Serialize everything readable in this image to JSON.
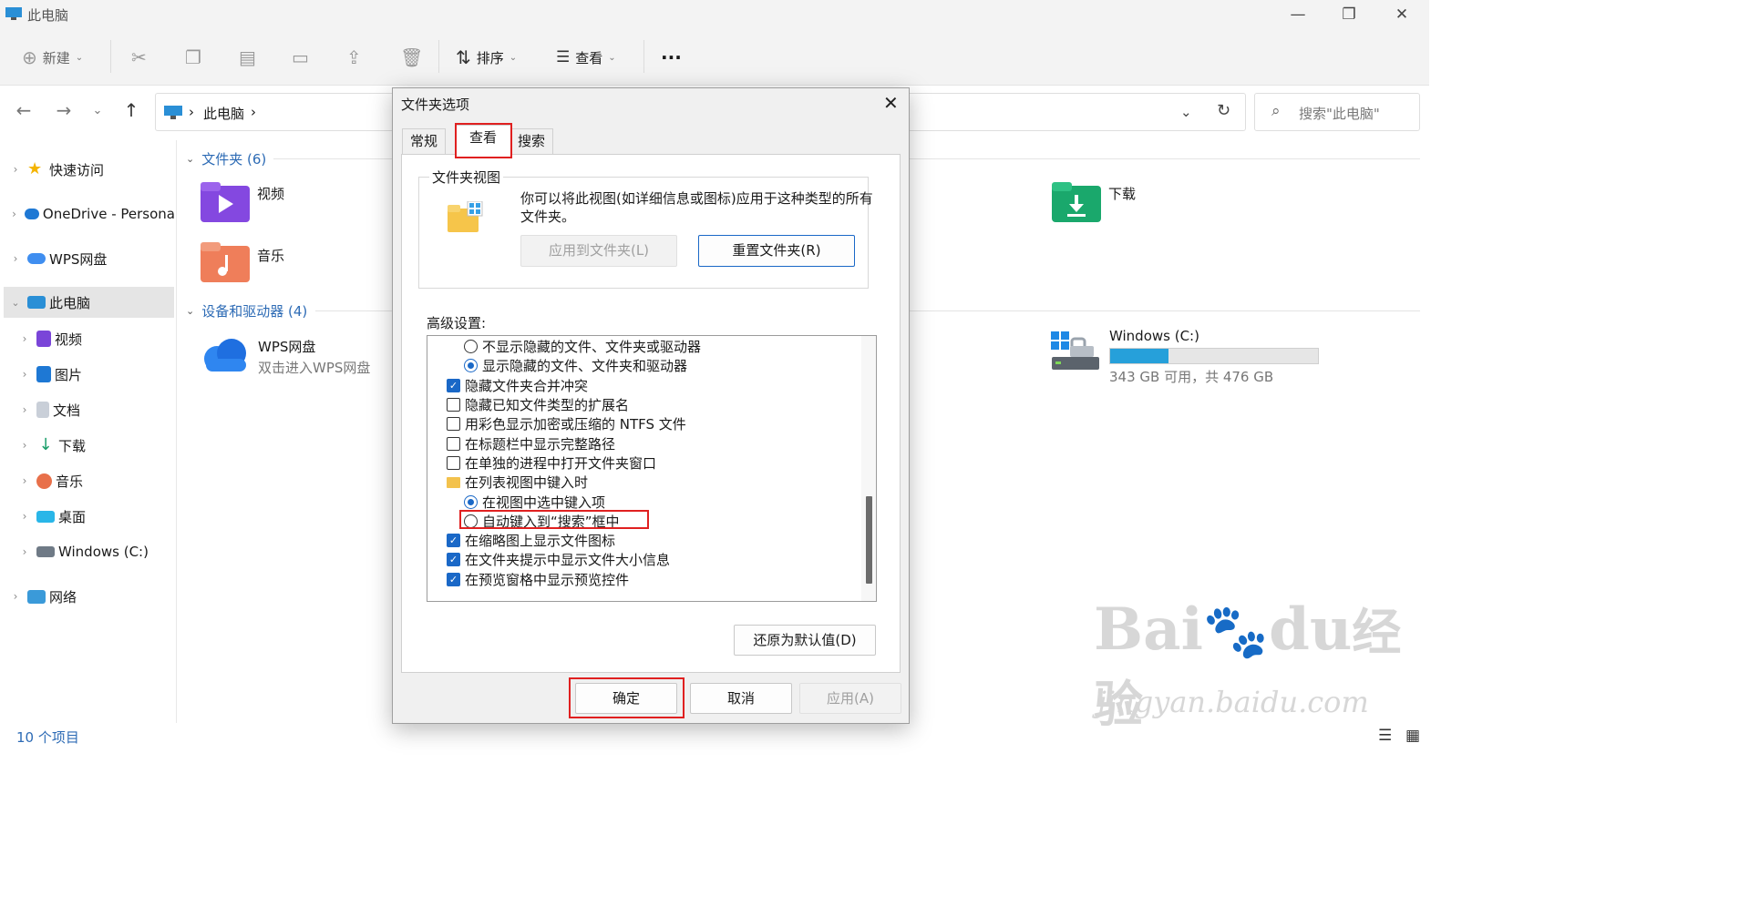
{
  "window": {
    "title": "此电脑",
    "controls": [
      "—",
      "❐",
      "✕"
    ]
  },
  "toolbar": {
    "new_label": "新建",
    "sort_label": "排序",
    "view_label": "查看",
    "more_label": "···"
  },
  "nav": {
    "breadcrumb": [
      "此电脑"
    ],
    "search_placeholder": "搜索\"此电脑\""
  },
  "sidebar": {
    "items": [
      {
        "label": "快速访问",
        "icon": "star-icon"
      },
      {
        "label": "OneDrive - Persona",
        "icon": "cloud-icon"
      },
      {
        "label": "WPS网盘",
        "icon": "wps-cloud-icon"
      },
      {
        "label": "此电脑",
        "icon": "pc-icon"
      },
      {
        "label": "视频",
        "icon": "video-icon"
      },
      {
        "label": "图片",
        "icon": "picture-icon"
      },
      {
        "label": "文档",
        "icon": "document-icon"
      },
      {
        "label": "下载",
        "icon": "download-icon"
      },
      {
        "label": "音乐",
        "icon": "music-icon"
      },
      {
        "label": "桌面",
        "icon": "desktop-icon"
      },
      {
        "label": "Windows (C:)",
        "icon": "drive-icon"
      },
      {
        "label": "网络",
        "icon": "network-icon"
      }
    ]
  },
  "main": {
    "folders_header": "文件夹 (6)",
    "devices_header": "设备和驱动器 (4)",
    "folders": [
      {
        "label": "视频"
      },
      {
        "label": "音乐"
      },
      {
        "label": "下载"
      }
    ],
    "wps": {
      "label": "WPS网盘",
      "sub": "双击进入WPS网盘"
    },
    "drive": {
      "label": "Windows (C:)",
      "sub": "343 GB 可用，共 476 GB",
      "used_fraction": 0.28
    }
  },
  "status": {
    "count": "10 个项目"
  },
  "dialog": {
    "title": "文件夹选项",
    "tabs": [
      "常规",
      "查看",
      "搜索"
    ],
    "active_tab": "查看",
    "group_title": "文件夹视图",
    "group_text_1": "你可以将此视图(如详细信息或图标)应用于这种类型的所有",
    "group_text_2": "文件夹。",
    "apply_to_folders": "应用到文件夹(L)",
    "reset_folders": "重置文件夹(R)",
    "advanced_label": "高级设置:",
    "tree": [
      {
        "kind": "radio",
        "checked": false,
        "indent": 1,
        "label": "不显示隐藏的文件、文件夹或驱动器"
      },
      {
        "kind": "radio",
        "checked": true,
        "indent": 1,
        "label": "显示隐藏的文件、文件夹和驱动器"
      },
      {
        "kind": "check",
        "checked": true,
        "indent": 0,
        "label": "隐藏文件夹合并冲突"
      },
      {
        "kind": "check",
        "checked": false,
        "indent": 0,
        "label": "隐藏已知文件类型的扩展名"
      },
      {
        "kind": "check",
        "checked": false,
        "indent": 0,
        "label": "用彩色显示加密或压缩的 NTFS 文件"
      },
      {
        "kind": "check",
        "checked": false,
        "indent": 0,
        "label": "在标题栏中显示完整路径"
      },
      {
        "kind": "check",
        "checked": false,
        "indent": 0,
        "label": "在单独的进程中打开文件夹窗口"
      },
      {
        "kind": "folder",
        "checked": false,
        "indent": 0,
        "label": "在列表视图中键入时"
      },
      {
        "kind": "radio",
        "checked": true,
        "indent": 1,
        "label": "在视图中选中键入项"
      },
      {
        "kind": "radio",
        "checked": false,
        "indent": 1,
        "label": "自动键入到“搜索”框中"
      },
      {
        "kind": "check",
        "checked": true,
        "indent": 0,
        "label": "在缩略图上显示文件图标"
      },
      {
        "kind": "check",
        "checked": true,
        "indent": 0,
        "label": "在文件夹提示中显示文件大小信息"
      },
      {
        "kind": "check",
        "checked": true,
        "indent": 0,
        "label": "在预览窗格中显示预览控件"
      }
    ],
    "restore_defaults": "还原为默认值(D)",
    "ok": "确定",
    "cancel": "取消",
    "apply": "应用(A)"
  },
  "watermark": {
    "brand": "Bai",
    "brand2": "du",
    "cn": "经验",
    "url": "jingyan.baidu.com"
  },
  "colors": {
    "accent": "#1a68c7",
    "highlight_box": "#e02020",
    "drive_bar": "#26a0da"
  }
}
